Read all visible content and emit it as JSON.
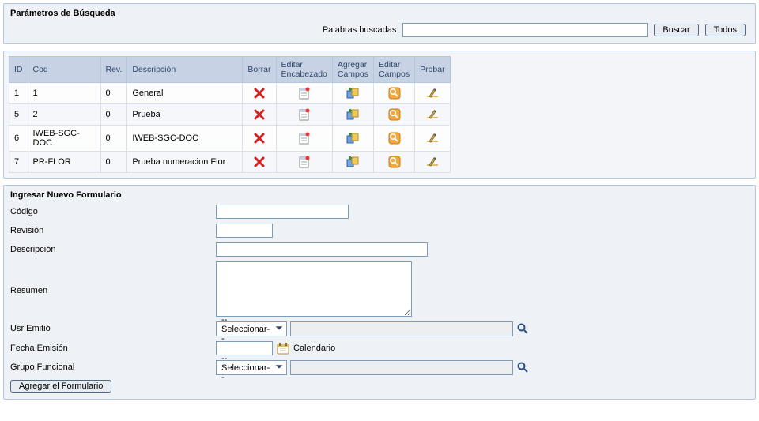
{
  "search_panel": {
    "title": "Parámetros de Búsqueda",
    "label": "Palabras buscadas",
    "input_value": "",
    "search_btn": "Buscar",
    "all_btn": "Todos"
  },
  "grid": {
    "headers": {
      "id": "ID",
      "cod": "Cod",
      "rev": "Rev.",
      "desc": "Descripción",
      "borrar": "Borrar",
      "editar_enc": "Editar Encabezado",
      "agregar_campos": "Agregar Campos",
      "editar_campos": "Editar Campos",
      "probar": "Probar"
    },
    "rows": [
      {
        "id": "1",
        "cod": "1",
        "rev": "0",
        "desc": "General"
      },
      {
        "id": "5",
        "cod": "2",
        "rev": "0",
        "desc": "Prueba"
      },
      {
        "id": "6",
        "cod": "IWEB-SGC-DOC",
        "rev": "0",
        "desc": "IWEB-SGC-DOC"
      },
      {
        "id": "7",
        "cod": "PR-FLOR",
        "rev": "0",
        "desc": "Prueba numeracion Flor"
      }
    ]
  },
  "form": {
    "title": "Ingresar Nuevo Formulario",
    "labels": {
      "codigo": "Código",
      "revision": "Revisión",
      "descripcion": "Descripción",
      "resumen": "Resumen",
      "usr_emitio": "Usr Emitió",
      "fecha_emision": "Fecha Emisión",
      "grupo_funcional": "Grupo Funcional",
      "calendario": "Calendario"
    },
    "values": {
      "codigo": "",
      "revision": "",
      "descripcion": "",
      "resumen": "",
      "usr_emitio_sel": "--Seleccionar--",
      "usr_emitio_display": "",
      "fecha_emision": "",
      "grupo_sel": "--Seleccionar--",
      "grupo_display": ""
    },
    "submit_btn": "Agregar el Formulario"
  }
}
